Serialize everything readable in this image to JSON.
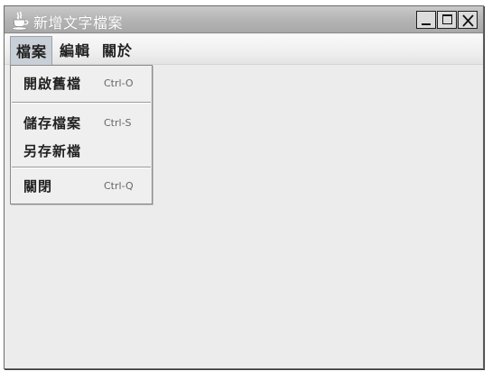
{
  "window": {
    "title": "新增文字檔案",
    "app_icon": "java-coffee-cup-icon",
    "controls": {
      "minimize": "minimize-icon",
      "maximize": "maximize-icon",
      "close": "close-icon"
    }
  },
  "menubar": {
    "items": [
      {
        "label": "檔案",
        "active": true
      },
      {
        "label": "編輯",
        "active": false
      },
      {
        "label": "關於",
        "active": false
      }
    ]
  },
  "file_menu": {
    "items": [
      {
        "label": "開啟舊檔",
        "accelerator": "Ctrl-O"
      },
      {
        "label": "儲存檔案",
        "accelerator": "Ctrl-S"
      },
      {
        "label": "另存新檔",
        "accelerator": ""
      },
      {
        "label": "關閉",
        "accelerator": "Ctrl-Q"
      }
    ]
  },
  "colors": {
    "titlebar": "#b5b5b5",
    "menubar": "#efefef",
    "active_menu": "#c9cfd6",
    "window_bg": "#ececec"
  }
}
